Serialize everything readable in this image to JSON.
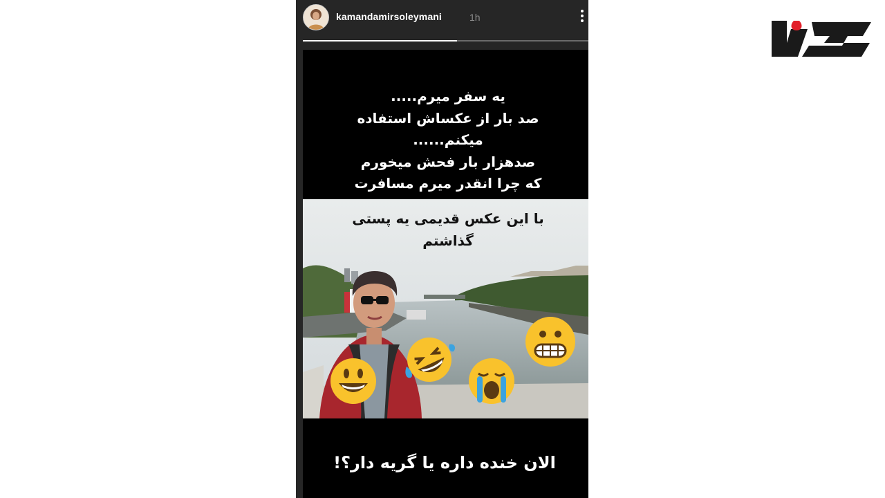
{
  "site_logo": {
    "text": "رکنا",
    "color": "#1a1a1a",
    "accent": "#e2202a"
  },
  "story": {
    "username": "kamandamirsoleymani",
    "time_ago": "1h",
    "progress": 0.54,
    "top_text_lines": [
      "یه سفر میرم.....",
      "صد بار از عکساش استفاده",
      "میکنم......",
      "صدهزار بار فحش میخورم",
      "که چرا انقدر میرم مسافرت"
    ],
    "photo_caption_lines": [
      "با این عکس قدیمی یه پستی",
      "گذاشتم"
    ],
    "bottom_text": "الان خنده داره یا گریه دار؟!",
    "emojis": [
      "grinning-face",
      "rofl-face",
      "loudly-crying-face",
      "grimacing-face"
    ]
  }
}
